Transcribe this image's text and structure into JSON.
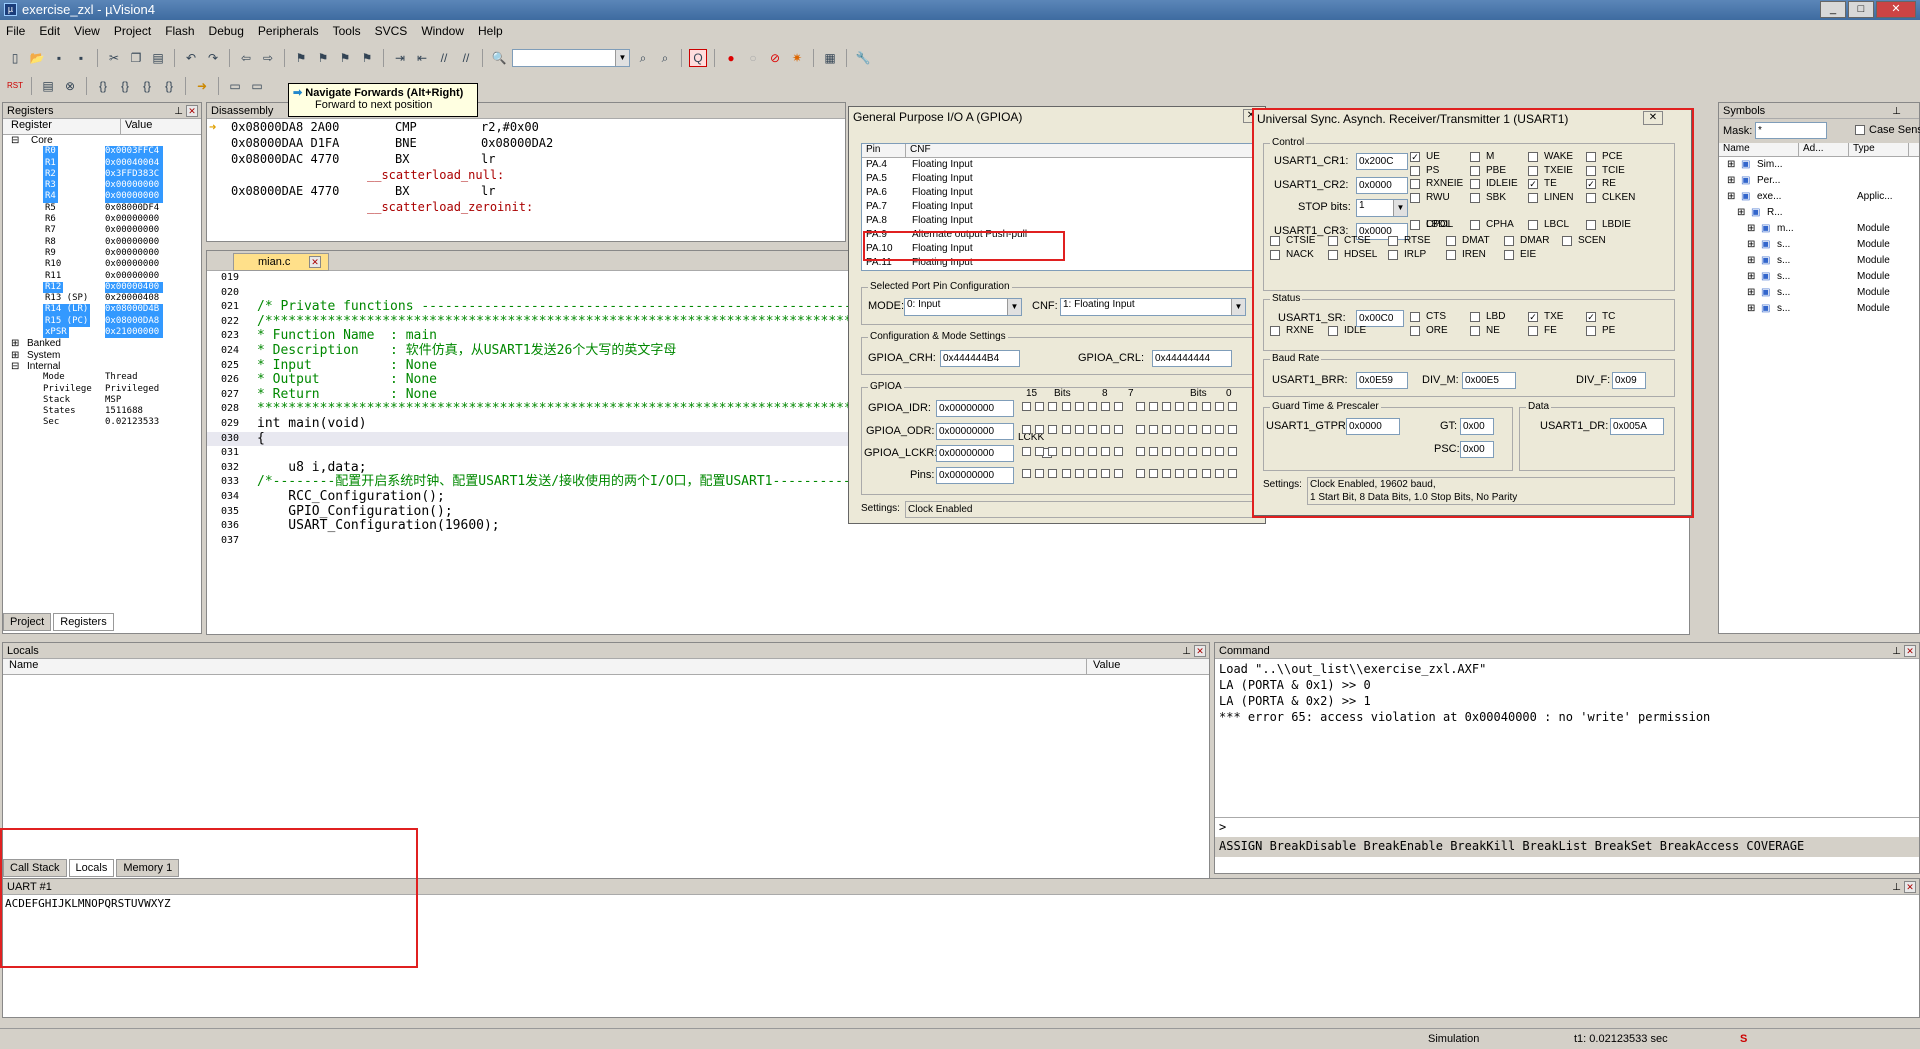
{
  "window": {
    "title": "exercise_zxl - µVision4"
  },
  "menu": [
    "File",
    "Edit",
    "View",
    "Project",
    "Flash",
    "Debug",
    "Peripherals",
    "Tools",
    "SVCS",
    "Window",
    "Help"
  ],
  "tooltip": {
    "title": "Navigate Forwards (Alt+Right)",
    "sub": "Forward to next position"
  },
  "registers": {
    "title": "Registers",
    "col_reg": "Register",
    "col_val": "Value",
    "core": "Core",
    "rows": [
      [
        "R0",
        "0x0003FFC4",
        true
      ],
      [
        "R1",
        "0x00040004",
        true
      ],
      [
        "R2",
        "0x3FFD383C",
        true
      ],
      [
        "R3",
        "0x00000000",
        true
      ],
      [
        "R4",
        "0x00000000",
        true
      ],
      [
        "R5",
        "0x08000DF4",
        false
      ],
      [
        "R6",
        "0x00000000",
        false
      ],
      [
        "R7",
        "0x00000000",
        false
      ],
      [
        "R8",
        "0x00000000",
        false
      ],
      [
        "R9",
        "0x00000000",
        false
      ],
      [
        "R10",
        "0x00000000",
        false
      ],
      [
        "R11",
        "0x00000000",
        false
      ],
      [
        "R12",
        "0x00000400",
        true
      ],
      [
        "R13 (SP)",
        "0x20000408",
        false
      ],
      [
        "R14 (LR)",
        "0x08000D4B",
        true
      ],
      [
        "R15 (PC)",
        "0x08000DA8",
        true
      ],
      [
        "xPSR",
        "0x21000000",
        true
      ]
    ],
    "groups": [
      "Banked",
      "System",
      "Internal"
    ],
    "internal": [
      [
        "Mode",
        "Thread"
      ],
      [
        "Privilege",
        "Privileged"
      ],
      [
        "Stack",
        "MSP"
      ],
      [
        "States",
        "1511688"
      ],
      [
        "Sec",
        "0.02123533"
      ]
    ],
    "tabs": [
      "Project",
      "Registers"
    ]
  },
  "disasm": {
    "title": "Disassembly",
    "lines": [
      [
        "0x08000DA8 2A00",
        "CMP",
        "r2,#0x00"
      ],
      [
        "0x08000DAA D1FA",
        "BNE",
        "0x08000DA2"
      ],
      [
        "0x08000DAC 4770",
        "BX",
        "lr"
      ],
      [
        "",
        "__scatterload_null:",
        ""
      ],
      [
        "0x08000DAE 4770",
        "BX",
        "lr"
      ],
      [
        "",
        "__scatterload_zeroinit:",
        ""
      ]
    ]
  },
  "editor": {
    "tab": "mian.c",
    "lines": [
      [
        "019",
        ""
      ],
      [
        "020",
        ""
      ],
      [
        "021",
        "/* Private functions ---------------------------------------------------------"
      ],
      [
        "022",
        "/******************************************************************************"
      ],
      [
        "023",
        "* Function Name  : main"
      ],
      [
        "024",
        "* Description    : 软件仿真，从USART1发送26个大写的英文字母"
      ],
      [
        "025",
        "* Input          : None"
      ],
      [
        "026",
        "* Output         : None"
      ],
      [
        "027",
        "* Return         : None"
      ],
      [
        "028",
        "*******************************************************************************"
      ],
      [
        "029",
        "int main(void)"
      ],
      [
        "030",
        "{"
      ],
      [
        "031",
        ""
      ],
      [
        "032",
        "    u8 i,data;"
      ],
      [
        "033",
        "/*--------配置开启系统时钟、配置USART1发送/接收使用的两个I/O口，配置USART1-----------------------------------------*/"
      ],
      [
        "034",
        "    RCC_Configuration();"
      ],
      [
        "035",
        "    GPIO_Configuration();"
      ],
      [
        "036",
        "    USART_Configuration(19600);"
      ],
      [
        "037",
        ""
      ]
    ]
  },
  "gpio": {
    "title": "General Purpose I/O A (GPIOA)",
    "col_pin": "Pin",
    "col_cnf": "CNF",
    "pins": [
      [
        "PA.4",
        "Floating Input"
      ],
      [
        "PA.5",
        "Floating Input"
      ],
      [
        "PA.6",
        "Floating Input"
      ],
      [
        "PA.7",
        "Floating Input"
      ],
      [
        "PA.8",
        "Floating Input"
      ],
      [
        "PA.9",
        "Alternate output Push-pull"
      ],
      [
        "PA.10",
        "Floating Input"
      ],
      [
        "PA.11",
        "Floating Input"
      ]
    ],
    "sel_title": "Selected Port Pin Configuration",
    "mode_label": "MODE:",
    "mode_val": "0: Input",
    "cnf_label": "CNF:",
    "cnf_val": "1: Floating Input",
    "cfg_title": "Configuration & Mode Settings",
    "crh_label": "GPIOA_CRH:",
    "crh": "0x444444B4",
    "crl_label": "GPIOA_CRL:",
    "crl": "0x44444444",
    "grp": "GPIOA",
    "idr_label": "GPIOA_IDR:",
    "idr": "0x00000000",
    "odr_label": "GPIOA_ODR:",
    "odr": "0x00000000",
    "lckr_label": "GPIOA_LCKR:",
    "lckr": "0x00000000",
    "pins_label": "Pins:",
    "pins_val": "0x00000000",
    "lckk": "LCKK",
    "bits": [
      "15",
      "Bits",
      "8",
      "7",
      "Bits",
      "0"
    ],
    "settings_label": "Settings:",
    "settings": "Clock Enabled"
  },
  "usart": {
    "title": "Universal Sync. Asynch. Receiver/Transmitter 1 (USART1)",
    "control": "Control",
    "cr1_label": "USART1_CR1:",
    "cr1": "0x200C",
    "cr2_label": "USART1_CR2:",
    "cr2": "0x0000",
    "stop_label": "STOP bits:",
    "stop": "1",
    "cr3_label": "USART1_CR3:",
    "cr3": "0x0000",
    "flags_ctrl": [
      [
        "UE",
        true
      ],
      [
        "M",
        false
      ],
      [
        "WAKE",
        false
      ],
      [
        "PCE",
        false
      ],
      [
        "PS",
        false
      ],
      [
        "PBE",
        false
      ],
      [
        "TXEIE",
        false
      ],
      [
        "TCIE",
        false
      ],
      [
        "RXNEIE",
        false
      ],
      [
        "IDLEIE",
        false
      ],
      [
        "TE",
        true
      ],
      [
        "RE",
        true
      ],
      [
        "RWU",
        false
      ],
      [
        "SBK",
        false
      ],
      [
        "LINEN",
        false
      ],
      [
        "CLKEN",
        false
      ],
      [
        "CPOL",
        false
      ],
      [
        "CPHA",
        false
      ],
      [
        "LBCL",
        false
      ],
      [
        "LBDIE",
        false
      ],
      [
        "LBDL",
        false
      ],
      [
        "CTSIE",
        false
      ],
      [
        "CTSE",
        false
      ],
      [
        "RTSE",
        false
      ],
      [
        "DMAT",
        false
      ],
      [
        "DMAR",
        false
      ],
      [
        "SCEN",
        false
      ],
      [
        "NACK",
        false
      ],
      [
        "HDSEL",
        false
      ],
      [
        "IRLP",
        false
      ],
      [
        "IREN",
        false
      ],
      [
        "EIE",
        false
      ]
    ],
    "status": "Status",
    "sr_label": "USART1_SR:",
    "sr": "0x00C0",
    "flags_status": [
      [
        "CTS",
        false
      ],
      [
        "LBD",
        false
      ],
      [
        "TXE",
        true
      ],
      [
        "TC",
        true
      ],
      [
        "RXNE",
        false
      ],
      [
        "IDLE",
        false
      ],
      [
        "ORE",
        false
      ],
      [
        "NE",
        false
      ],
      [
        "FE",
        false
      ],
      [
        "PE",
        false
      ]
    ],
    "baud": "Baud Rate",
    "brr_label": "USART1_BRR:",
    "brr": "0x0E59",
    "divm_label": "DIV_M:",
    "divm": "0x00E5",
    "divf_label": "DIV_F:",
    "divf": "0x09",
    "guard": "Guard Time & Prescaler",
    "gtpr_label": "USART1_GTPR:",
    "gtpr": "0x0000",
    "gt_label": "GT:",
    "gt": "0x00",
    "psc_label": "PSC:",
    "psc": "0x00",
    "data": "Data",
    "dr_label": "USART1_DR:",
    "dr": "0x005A",
    "settings_label": "Settings:",
    "settings1": "Clock Enabled,   19602 baud,",
    "settings2": "1 Start Bit, 8 Data Bits, 1.0 Stop Bits, No Parity"
  },
  "symbols": {
    "title": "Symbols",
    "mask_label": "Mask:",
    "mask": "*",
    "case": "Case Sens",
    "cols": [
      "Name",
      "Ad...",
      "Type"
    ],
    "items": [
      [
        "Sim...",
        ""
      ],
      [
        "Per...",
        ""
      ],
      [
        "exe...",
        "Applic..."
      ],
      [
        "R...",
        ""
      ],
      [
        "m...",
        "Module"
      ],
      [
        "s...",
        "Module"
      ],
      [
        "s...",
        "Module"
      ],
      [
        "s...",
        "Module"
      ],
      [
        "s...",
        "Module"
      ],
      [
        "s...",
        "Module"
      ]
    ]
  },
  "locals": {
    "title": "Locals",
    "col_name": "Name",
    "col_val": "Value",
    "tabs": [
      "Call Stack",
      "Locals",
      "Memory 1"
    ]
  },
  "command": {
    "title": "Command",
    "lines": [
      "Load \"..\\\\out_list\\\\exercise_zxl.AXF\"",
      "LA (PORTA & 0x1) >> 0",
      "LA (PORTA & 0x2) >> 1",
      "*** error 65: access violation at 0x00040000 : no 'write' permission"
    ],
    "prompt": ">",
    "hint": "ASSIGN BreakDisable BreakEnable BreakKill BreakList BreakSet BreakAccess COVERAGE"
  },
  "uart": {
    "title": "UART #1",
    "text": "ACDEFGHIJKLMNOPQRSTUVWXYZ"
  },
  "status": {
    "mode": "Simulation",
    "time": "t1: 0.02123533 sec"
  }
}
